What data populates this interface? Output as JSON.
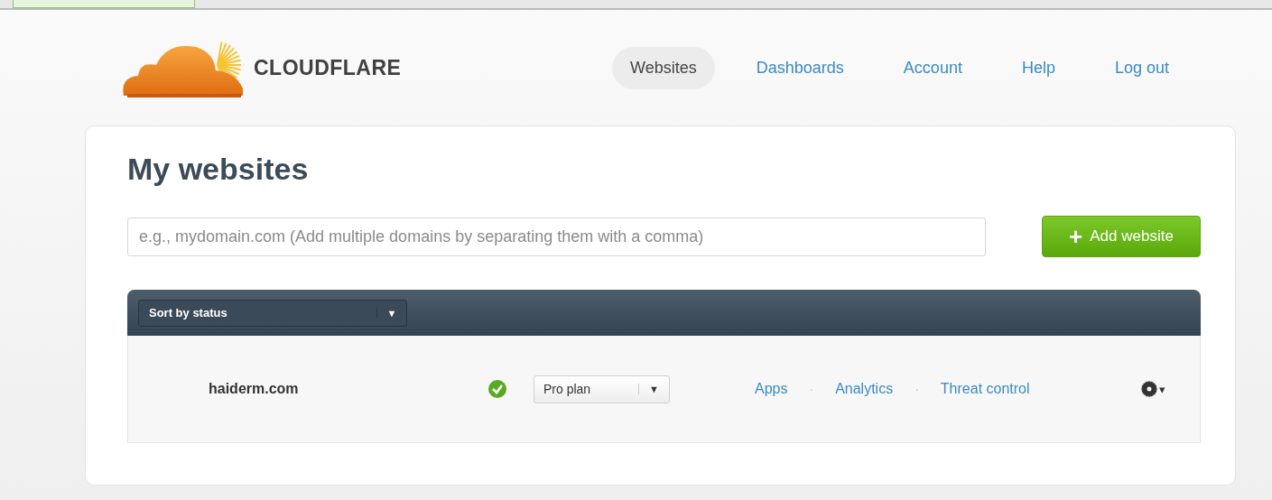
{
  "header": {
    "logo_text": "CLOUDFLARE",
    "nav": [
      {
        "label": "Websites",
        "selected": true
      },
      {
        "label": "Dashboards",
        "selected": false
      },
      {
        "label": "Account",
        "selected": false
      },
      {
        "label": "Help",
        "selected": false
      },
      {
        "label": "Log out",
        "selected": false
      }
    ]
  },
  "card": {
    "title": "My websites",
    "domain_field": {
      "placeholder": "e.g., mydomain.com (Add multiple domains by separating them with a comma)"
    },
    "add_button": {
      "icon": "+",
      "label": "Add website"
    },
    "sort_select": {
      "value": "Sort by status",
      "arrow": "▼"
    },
    "sites": [
      {
        "domain": "haiderm.com",
        "online": true,
        "plan": {
          "value": "Pro plan",
          "arrow": "▼"
        },
        "links": [
          "Apps",
          "Analytics",
          "Threat control"
        ],
        "separators": [
          "·",
          "·"
        ],
        "settings_caret": "▾"
      }
    ]
  }
}
